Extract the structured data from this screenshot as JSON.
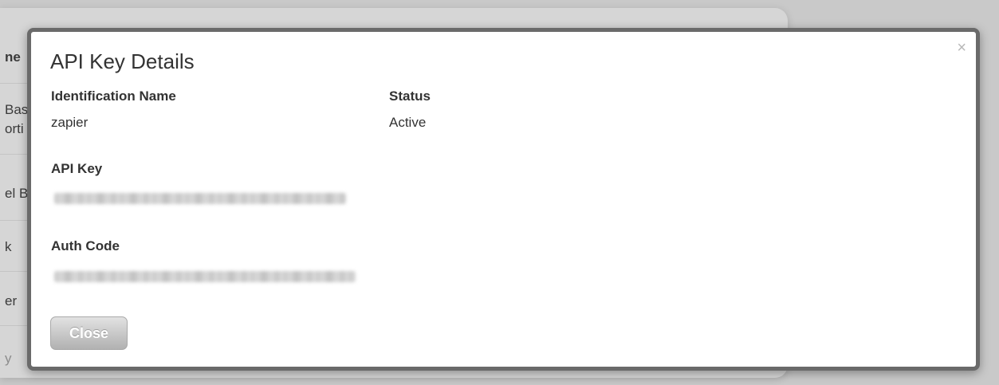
{
  "background": {
    "fragments": [
      "ne",
      "Bas",
      "orti",
      "el B",
      "k",
      "er",
      "y"
    ]
  },
  "modal": {
    "title": "API Key Details",
    "close_icon": "×",
    "identification_name": {
      "label": "Identification Name",
      "value": "zapier"
    },
    "status": {
      "label": "Status",
      "value": "Active"
    },
    "api_key": {
      "label": "API Key"
    },
    "auth_code": {
      "label": "Auth Code"
    },
    "close_button": "Close"
  }
}
